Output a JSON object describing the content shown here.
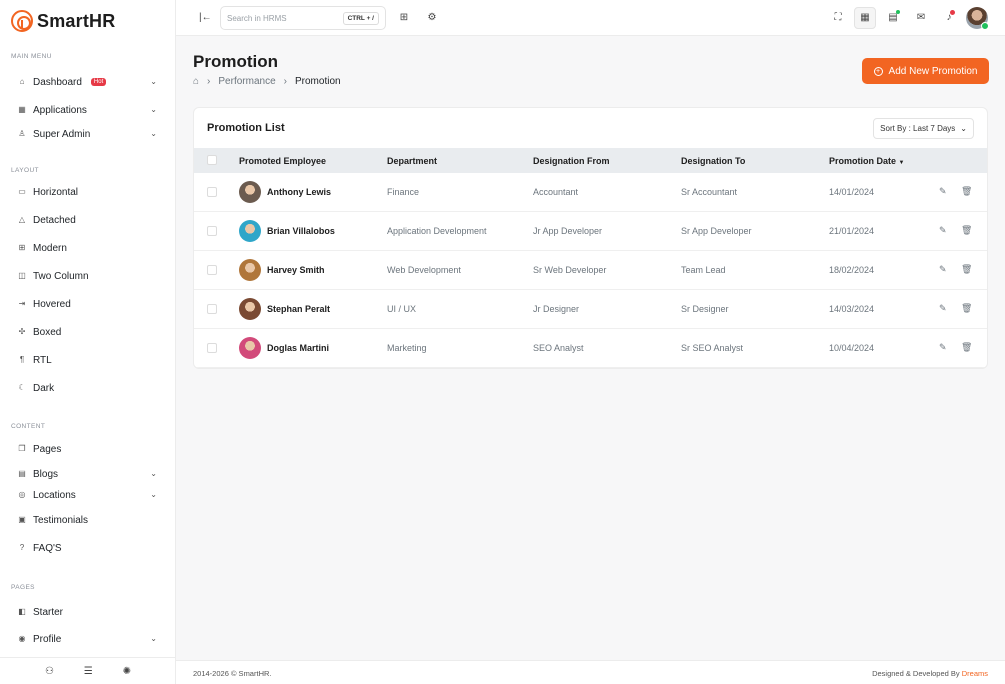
{
  "brand": {
    "name_a": "Smart",
    "name_b": "HR"
  },
  "sidebar": {
    "main_menu_title": "MAIN MENU",
    "main_items": [
      {
        "label": "Dashboard",
        "icon": "home-icon",
        "badge": "Hot",
        "has_chevron": true
      },
      {
        "label": "Applications",
        "icon": "grid-icon",
        "has_chevron": true
      },
      {
        "label": "Super Admin",
        "icon": "user-star-icon",
        "has_chevron": true
      }
    ],
    "layout_title": "LAYOUT",
    "layout_items": [
      {
        "label": "Horizontal",
        "icon": "layout-horizontal-icon"
      },
      {
        "label": "Detached",
        "icon": "triangle-icon"
      },
      {
        "label": "Modern",
        "icon": "grid-four-icon"
      },
      {
        "label": "Two Column",
        "icon": "columns-icon"
      },
      {
        "label": "Hovered",
        "icon": "hover-icon"
      },
      {
        "label": "Boxed",
        "icon": "box-icon"
      },
      {
        "label": "RTL",
        "icon": "rtl-icon"
      },
      {
        "label": "Dark",
        "icon": "moon-icon"
      }
    ],
    "content_title": "CONTENT",
    "content_items": [
      {
        "label": "Pages",
        "icon": "pages-icon"
      },
      {
        "label": "Blogs",
        "icon": "blog-icon",
        "has_chevron": true
      },
      {
        "label": "Locations",
        "icon": "location-icon",
        "has_chevron": true
      },
      {
        "label": "Testimonials",
        "icon": "message-icon"
      },
      {
        "label": "FAQ'S",
        "icon": "question-icon"
      }
    ],
    "pages_title": "PAGES",
    "pages_items": [
      {
        "label": "Starter",
        "icon": "layout-icon"
      },
      {
        "label": "Profile",
        "icon": "user-circle-icon",
        "has_chevron": true
      }
    ]
  },
  "topbar": {
    "search_placeholder": "Search in HRMS",
    "shortcut": "CTRL + /"
  },
  "page": {
    "title": "Promotion",
    "breadcrumb": [
      "Performance",
      "Promotion"
    ],
    "add_button": "Add New Promotion"
  },
  "card": {
    "title": "Promotion List",
    "sort_label": "Sort By : Last 7 Days",
    "columns": [
      "Promoted Employee",
      "Department",
      "Designation From",
      "Designation To",
      "Promotion Date"
    ],
    "rows": [
      {
        "name": "Anthony Lewis",
        "department": "Finance",
        "from": "Accountant",
        "to": "Sr Accountant",
        "date": "14/01/2024",
        "avatar_color": "#6b5b4f"
      },
      {
        "name": "Brian Villalobos",
        "department": "Application Development",
        "from": "Jr App Developer",
        "to": "Sr App Developer",
        "date": "21/01/2024",
        "avatar_color": "#2fa6c9"
      },
      {
        "name": "Harvey Smith",
        "department": "Web Development",
        "from": "Sr Web Developer",
        "to": "Team Lead",
        "date": "18/02/2024",
        "avatar_color": "#b0763a"
      },
      {
        "name": "Stephan Peralt",
        "department": "UI / UX",
        "from": "Jr Designer",
        "to": "Sr Designer",
        "date": "14/03/2024",
        "avatar_color": "#7a4a33"
      },
      {
        "name": "Doglas Martini",
        "department": "Marketing",
        "from": "SEO Analyst",
        "to": "Sr SEO Analyst",
        "date": "10/04/2024",
        "avatar_color": "#d24a7a"
      }
    ]
  },
  "footer": {
    "copyright": "2014-2026 © SmartHR.",
    "credit": "Designed & Developed By",
    "credit_brand": "Dreams"
  },
  "colors": {
    "accent": "#f26522",
    "badge": "#e63946"
  }
}
